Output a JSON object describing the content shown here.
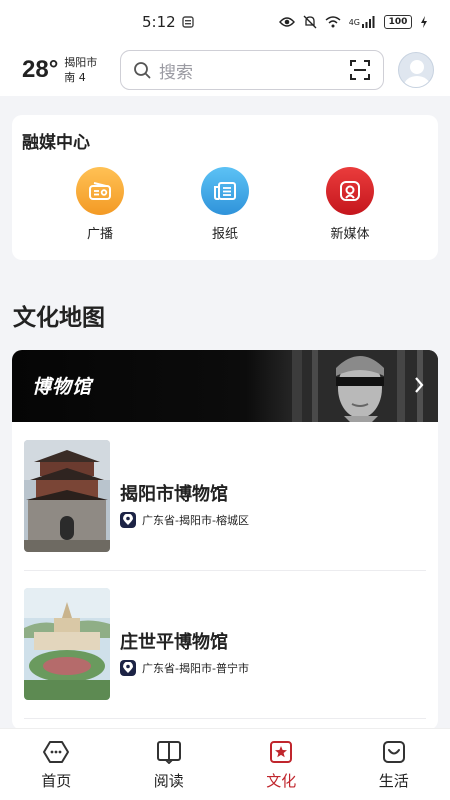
{
  "status_bar": {
    "time": "5:12",
    "network": "4G",
    "battery": "100"
  },
  "header": {
    "temperature": "28°",
    "city": "揭阳市",
    "wind": "南 4",
    "search_placeholder": "搜索"
  },
  "media_center": {
    "title": "融媒中心",
    "items": [
      {
        "label": "广播",
        "color": "#f6a234",
        "icon": "radio-icon"
      },
      {
        "label": "报纸",
        "color": "#3aa6e6",
        "icon": "newspaper-icon"
      },
      {
        "label": "新媒体",
        "color": "#d9232b",
        "icon": "new-media-icon"
      }
    ]
  },
  "culture_map": {
    "title": "文化地图",
    "banner_title": "博物馆",
    "museums": [
      {
        "name": "揭阳市博物馆",
        "location": "广东省-揭阳市-榕城区"
      },
      {
        "name": "庄世平博物馆",
        "location": "广东省-揭阳市-普宁市"
      }
    ]
  },
  "tabbar": {
    "tabs": [
      {
        "label": "首页",
        "icon": "home-icon"
      },
      {
        "label": "阅读",
        "icon": "book-icon"
      },
      {
        "label": "文化",
        "icon": "culture-icon",
        "active": true
      },
      {
        "label": "生活",
        "icon": "life-icon"
      }
    ],
    "active_color": "#c0262d"
  }
}
